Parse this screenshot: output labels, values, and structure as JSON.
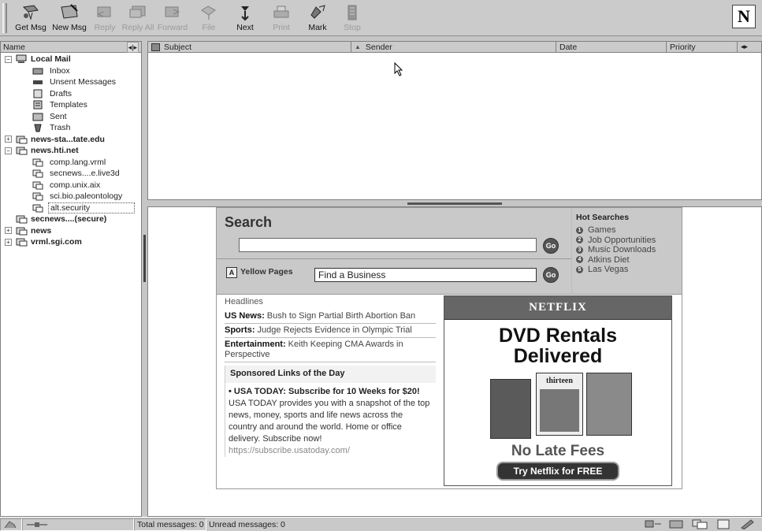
{
  "toolbar": {
    "buttons": [
      {
        "label": "Get Msg",
        "enabled": true
      },
      {
        "label": "New Msg",
        "enabled": true
      },
      {
        "label": "Reply",
        "enabled": false
      },
      {
        "label": "Reply All",
        "enabled": false
      },
      {
        "label": "Forward",
        "enabled": false
      },
      {
        "label": "File",
        "enabled": false
      },
      {
        "label": "Next",
        "enabled": true
      },
      {
        "label": "Print",
        "enabled": false
      },
      {
        "label": "Mark",
        "enabled": true
      },
      {
        "label": "Stop",
        "enabled": false
      }
    ],
    "logo": "N"
  },
  "folders": {
    "header": "Name",
    "header_arrows": "◂|▸",
    "tree": [
      {
        "label": "Local Mail",
        "bold": true,
        "toggle": "−",
        "icon": "computer-icon"
      },
      {
        "label": "Inbox",
        "icon": "inbox-icon"
      },
      {
        "label": "Unsent Messages",
        "icon": "unsent-icon"
      },
      {
        "label": "Drafts",
        "icon": "drafts-icon"
      },
      {
        "label": "Templates",
        "icon": "templates-icon"
      },
      {
        "label": "Sent",
        "icon": "sent-icon"
      },
      {
        "label": "Trash",
        "icon": "trash-icon"
      },
      {
        "label": "news-sta...tate.edu",
        "bold": true,
        "toggle": "+",
        "icon": "news-server-icon"
      },
      {
        "label": "news.hti.net",
        "bold": true,
        "toggle": "−",
        "icon": "news-server-icon"
      },
      {
        "label": "comp.lang.vrml",
        "icon": "newsgroup-icon"
      },
      {
        "label": "secnews....e.live3d",
        "icon": "newsgroup-icon"
      },
      {
        "label": "comp.unix.aix",
        "icon": "newsgroup-icon"
      },
      {
        "label": "sci.bio.paleontology",
        "icon": "newsgroup-icon"
      },
      {
        "label": "alt.security",
        "icon": "newsgroup-icon",
        "selected": true
      },
      {
        "label": "secnews....(secure)",
        "bold": true,
        "icon": "news-server-icon"
      },
      {
        "label": "news",
        "bold": true,
        "toggle": "+",
        "icon": "news-server-icon"
      },
      {
        "label": "vrml.sgi.com",
        "bold": true,
        "toggle": "+",
        "icon": "news-server-icon"
      }
    ]
  },
  "message_list": {
    "columns": {
      "subject": "Subject",
      "sender": "Sender",
      "date": "Date",
      "priority": "Priority"
    },
    "scroll_arrows": "◂▸"
  },
  "portal": {
    "search_title": "Search",
    "search_value": "",
    "go_label": "Go",
    "yellow_pages_label": "Yellow Pages",
    "yellow_pages_value": "Find a Business",
    "hot_searches_title": "Hot Searches",
    "hot_searches": [
      {
        "n": "1",
        "label": "Games"
      },
      {
        "n": "2",
        "label": "Job Opportunities"
      },
      {
        "n": "3",
        "label": "Music Downloads"
      },
      {
        "n": "4",
        "label": "Atkins Diet"
      },
      {
        "n": "5",
        "label": "Las Vegas"
      }
    ],
    "headlines_title": "Headlines",
    "headlines": [
      {
        "cat": "US News:",
        "text": " Bush to Sign Partial Birth Abortion Ban"
      },
      {
        "cat": "Sports:",
        "text": " Judge Rejects Evidence in Olympic Trial"
      },
      {
        "cat": "Entertainment:",
        "text": " Keith Keeping CMA Awards in Perspective"
      }
    ],
    "sponsored_title": "Sponsored Links of the Day",
    "sponsored_headline": "• USA TODAY: Subscribe for 10 Weeks for $20!",
    "sponsored_body": "USA TODAY provides you with a snapshot of the top news, money, sports and life news across the country and around the world. Home or office delivery. Subscribe now!",
    "sponsored_url": "https://subscribe.usatoday.com/",
    "ad": {
      "brand": "NETFLIX",
      "headline_line1": "DVD Rentals",
      "headline_line2": "Delivered",
      "poster_center": "thirteen",
      "fees": "No Late Fees",
      "cta": "Try Netflix for FREE"
    }
  },
  "status": {
    "total": "Total messages: 0",
    "unread": "Unread messages: 0"
  }
}
